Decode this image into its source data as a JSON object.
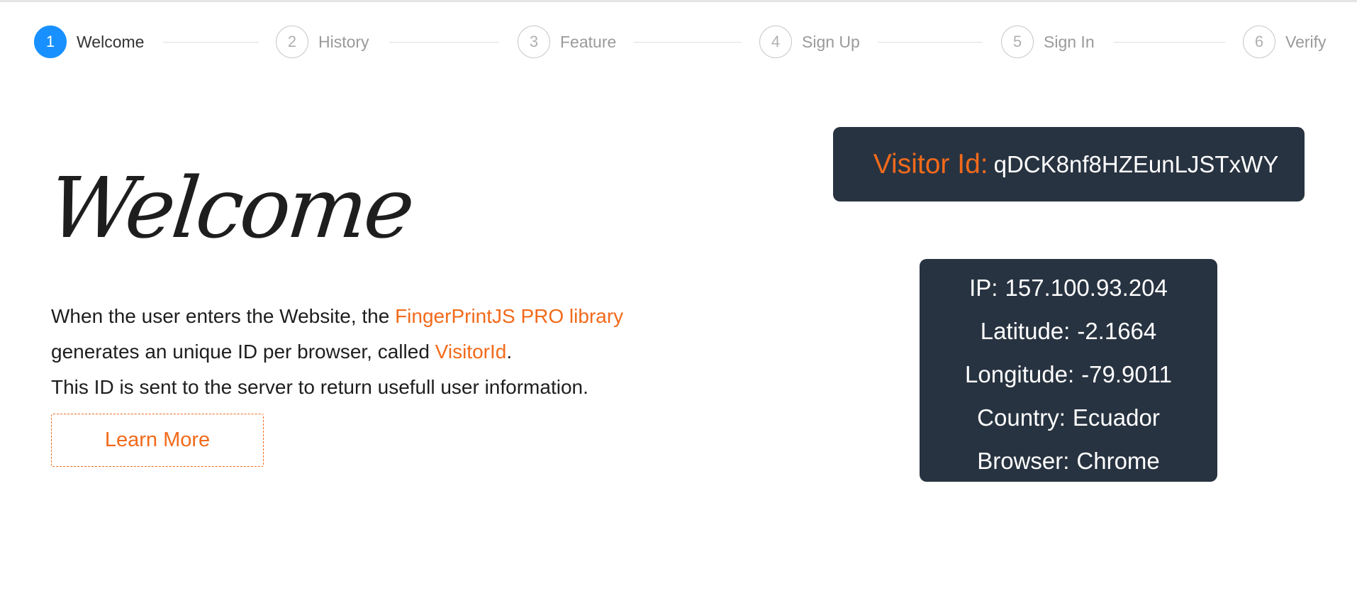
{
  "steps": [
    {
      "number": "1",
      "label": "Welcome",
      "active": true
    },
    {
      "number": "2",
      "label": "History",
      "active": false
    },
    {
      "number": "3",
      "label": "Feature",
      "active": false
    },
    {
      "number": "4",
      "label": "Sign Up",
      "active": false
    },
    {
      "number": "5",
      "label": "Sign In",
      "active": false
    },
    {
      "number": "6",
      "label": "Verify",
      "active": false
    }
  ],
  "main": {
    "title": "Welcome",
    "intro_part1": "When the user enters the Website, the ",
    "intro_link_library": "FingerPrintJS PRO library",
    "intro_part2": "generates an unique ID per browser, called ",
    "intro_link_visitor": "VisitorId",
    "intro_part3": ".",
    "intro_line3": "This ID is sent to the server to return usefull user information.",
    "learn_more_label": "Learn More"
  },
  "visitor": {
    "label": "Visitor Id:",
    "value": "qDCK8nf8HZEunLJSTxWY"
  },
  "info": {
    "ip_label": "IP:",
    "ip_value": "157.100.93.204",
    "latitude_label": "Latitude:",
    "latitude_value": "-2.1664",
    "longitude_label": "Longitude:",
    "longitude_value": "-79.9011",
    "country_label": "Country:",
    "country_value": "Ecuador",
    "browser_label": "Browser:",
    "browser_value": "Chrome"
  },
  "colors": {
    "accent_orange": "#f26a1b",
    "active_step_blue": "#1890ff",
    "panel_dark": "#283341"
  }
}
